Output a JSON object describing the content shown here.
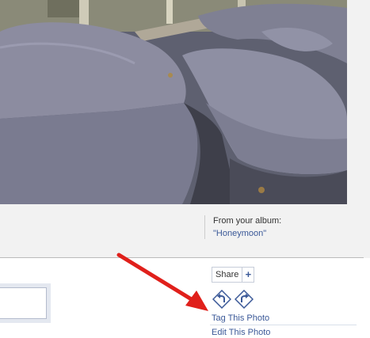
{
  "photo": {
    "alt": ""
  },
  "album": {
    "label": "From your album:",
    "name": "\"Honeymoon\""
  },
  "actions": {
    "share_label": "Share",
    "share_plus": "+",
    "tag_photo": "Tag This Photo",
    "edit_photo": "Edit This Photo"
  },
  "icons": {
    "rotate_left": "rotate-left-icon",
    "rotate_right": "rotate-right-icon",
    "annotation": "red-arrow"
  },
  "colors": {
    "link": "#3b5998",
    "arrow": "#e0201b"
  }
}
